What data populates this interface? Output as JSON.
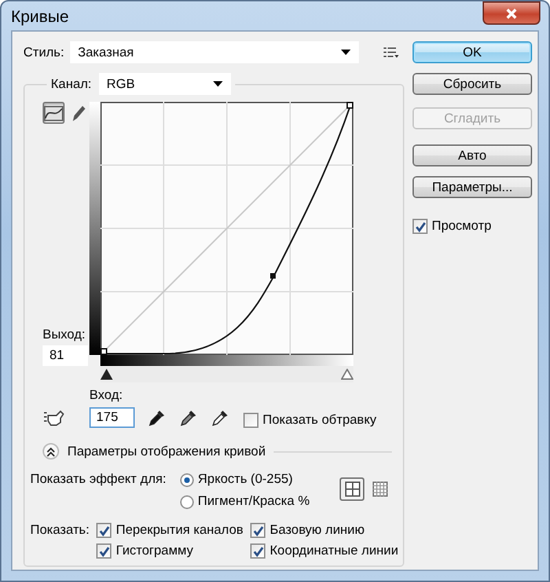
{
  "window": {
    "title": "Кривые"
  },
  "style": {
    "label": "Стиль:",
    "value": "Заказная"
  },
  "channel": {
    "label": "Канал:",
    "value": "RGB"
  },
  "tools": [
    {
      "kind": "curve",
      "selected": true
    },
    {
      "kind": "pencil",
      "selected": false
    }
  ],
  "output": {
    "label": "Выход:",
    "value": "81"
  },
  "input": {
    "label": "Вход:",
    "value": "175"
  },
  "input_sliders": [
    {
      "level": 0
    },
    {
      "level": 1
    }
  ],
  "show_clipping": {
    "label": "Показать обтравку",
    "checked": false
  },
  "curve_options": {
    "label": "Параметры отображения кривой",
    "expanded": true
  },
  "show_amount": {
    "label": "Показать эффект для:",
    "options": [
      {
        "label": "Яркость (0-255)",
        "selected": true
      },
      {
        "label": "Пигмент/Краска %",
        "selected": false
      }
    ]
  },
  "grid_sizes": [
    {
      "kind": "simple",
      "selected": true
    },
    {
      "kind": "detailed",
      "selected": false
    }
  ],
  "show": {
    "label": "Показать:",
    "options": [
      {
        "label": "Перекрытия каналов",
        "checked": true
      },
      {
        "label": "Базовую линию",
        "checked": true
      },
      {
        "label": "Гистограмму",
        "checked": true
      },
      {
        "label": "Координатные линии",
        "checked": true
      }
    ]
  },
  "buttons": [
    {
      "label": "OK",
      "default": true,
      "disabled": false
    },
    {
      "label": "Сбросить",
      "default": false,
      "disabled": false
    },
    {
      "label": "Сгладить",
      "default": false,
      "disabled": true
    },
    {
      "label": "Авто",
      "default": false,
      "disabled": false
    },
    {
      "label": "Параметры...",
      "default": false,
      "disabled": false
    }
  ],
  "preview": {
    "label": "Просмотр",
    "checked": true
  }
}
